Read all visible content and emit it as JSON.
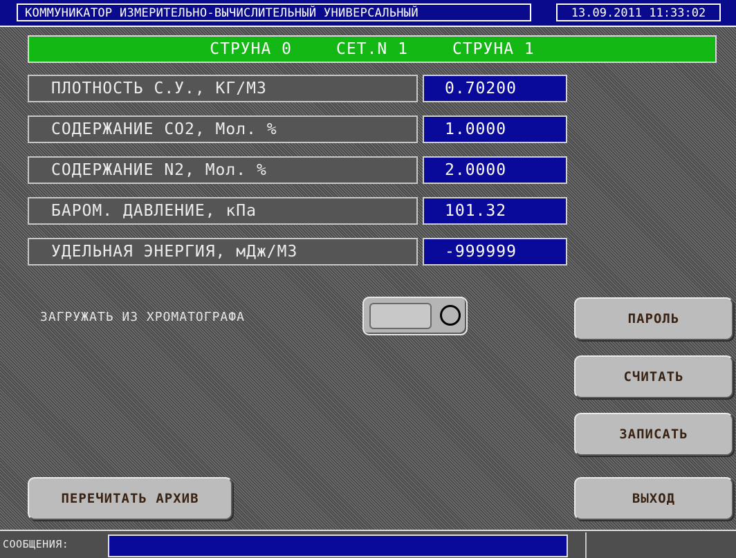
{
  "header": {
    "title": "КОММУНИКАТОР ИЗМЕРИТЕЛЬНО-ВЫЧИСЛИТЕЛЬНЫЙ УНИВЕРСАЛЬНЫЙ",
    "datetime": "13.09.2011 11:33:02"
  },
  "channel_bar": {
    "left": "СТРУНА 0",
    "middle": "СЕТ.N 1",
    "right": "СТРУНА 1",
    "color": "#14b814"
  },
  "params": [
    {
      "label": "ПЛОТНОСТЬ С.У., КГ/М3",
      "value": "0.70200"
    },
    {
      "label": "СОДЕРЖАНИЕ СО2, Мол. %",
      "value": "1.0000"
    },
    {
      "label": "СОДЕРЖАНИЕ N2, Мол. %",
      "value": "2.0000"
    },
    {
      "label": "БАРОМ. ДАВЛЕНИЕ, кПа",
      "value": "101.32"
    },
    {
      "label": "УДЕЛЬНАЯ ЭНЕРГИЯ, мДж/М3",
      "value": "-999999"
    }
  ],
  "chromatograph": {
    "label": "ЗАГРУЖАТЬ ИЗ ХРОМАТОГРАФА",
    "toggle_state": "off"
  },
  "buttons": {
    "password": "ПАРОЛЬ",
    "read": "СЧИТАТЬ",
    "write": "ЗАПИСАТЬ",
    "exit": "ВЫХОД",
    "reread_archive": "ПЕРЕЧИТАТЬ АРХИВ"
  },
  "status": {
    "label": "СООБЩЕНИЯ:",
    "message": ""
  },
  "colors": {
    "value_field": "#0a0a9a",
    "title_bar": "#0a0a8c",
    "button_text": "#3a2212"
  }
}
